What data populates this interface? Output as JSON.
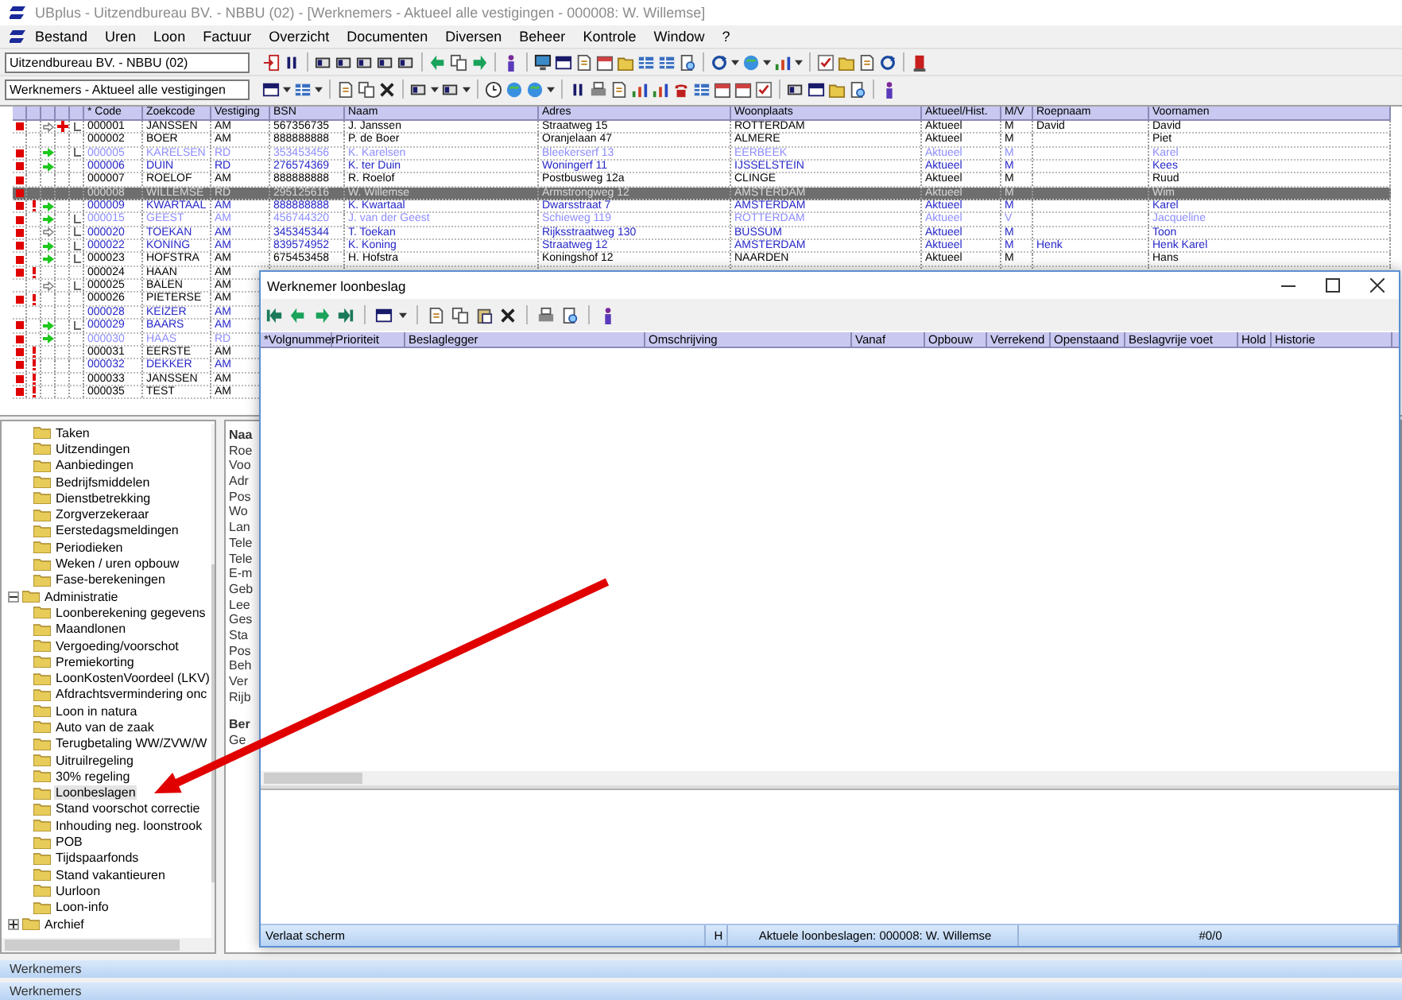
{
  "window": {
    "title": "UBplus - Uitzendbureau BV. - NBBU (02) - [Werknemers - Aktueel alle vestigingen - 000008: W. Willemse]"
  },
  "menu": [
    "Bestand",
    "Uren",
    "Loon",
    "Factuur",
    "Overzicht",
    "Documenten",
    "Diversen",
    "Beheer",
    "Kontrole",
    "Window",
    "?"
  ],
  "toolbar": {
    "company": "Uitzendbureau BV. - NBBU (02)",
    "view": "Werknemers - Aktueel alle vestigingen"
  },
  "table": {
    "columns": [
      "* Code",
      "Zoekcode",
      "Vestiging",
      "BSN",
      "Naam",
      "Adres",
      "Woonplaats",
      "Aktueel/Hist.",
      "M/V",
      "Roepnaam",
      "Voornamen"
    ],
    "rows": [
      {
        "code": "000001",
        "zoekcode": "JANSSEN",
        "vestiging": "AM",
        "bsn": "567356735",
        "naam": "J. Janssen",
        "adres": "Straatweg 15",
        "woonplaats": "ROTTERDAM",
        "aktueel": "Aktueel",
        "mv": "M",
        "roepnaam": "David",
        "voornamen": "David",
        "flag": true,
        "arrow": true,
        "arrow_filled": false,
        "cross": true,
        "link": true,
        "kind": "normal",
        "selected": false
      },
      {
        "code": "000002",
        "zoekcode": "BOER",
        "vestiging": "AM",
        "bsn": "888888888",
        "naam": "P. de Boer",
        "adres": "Oranjelaan 47",
        "woonplaats": "ALMERE",
        "aktueel": "Aktueel",
        "mv": "M",
        "voornamen": "Piet",
        "kind": "normal",
        "selected": false
      },
      {
        "code": "000005",
        "zoekcode": "KARELSEN",
        "vestiging": "RD",
        "bsn": "353453456",
        "naam": "K. Karelsen",
        "adres": "Bleekerserf 13",
        "woonplaats": "EERBEEK",
        "aktueel": "Aktueel",
        "mv": "M",
        "voornamen": "Karel",
        "flag": true,
        "arrow": true,
        "arrow_filled": true,
        "link": true,
        "kind": "light",
        "selected": false
      },
      {
        "code": "000006",
        "zoekcode": "DUIN",
        "vestiging": "RD",
        "bsn": "276574369",
        "naam": "K. ter Duin",
        "adres": "Woningerf 11",
        "woonplaats": "IJSSELSTEIN",
        "aktueel": "Aktueel",
        "mv": "M",
        "voornamen": "Kees",
        "flag": true,
        "arrow": true,
        "arrow_filled": true,
        "kind": "blue",
        "selected": false
      },
      {
        "code": "000007",
        "zoekcode": "ROELOF",
        "vestiging": "AM",
        "bsn": "888888888",
        "naam": "R. Roelof",
        "adres": "Postbusweg 12a",
        "woonplaats": "CLINGE",
        "aktueel": "Aktueel",
        "mv": "M",
        "voornamen": "Ruud",
        "flag": true,
        "kind": "normal",
        "selected": false
      },
      {
        "code": "000008",
        "zoekcode": "WILLEMSE",
        "vestiging": "RD",
        "bsn": "295125616",
        "naam": "W. Willemse",
        "adres": "Armstrongweg 12",
        "woonplaats": "AMSTERDAM",
        "aktueel": "Aktueel",
        "mv": "M",
        "voornamen": "Wim",
        "flag": true,
        "kind": "normal",
        "selected": true
      },
      {
        "code": "000009",
        "zoekcode": "KWARTAAL",
        "vestiging": "AM",
        "bsn": "888888888",
        "naam": "K. Kwartaal",
        "adres": "Dwarsstraat 7",
        "woonplaats": "AMSTERDAM",
        "aktueel": "Aktueel",
        "mv": "M",
        "voornamen": "Karel",
        "flag": true,
        "alert": true,
        "arrow": true,
        "arrow_filled": true,
        "kind": "blue",
        "selected": false
      },
      {
        "code": "000015",
        "zoekcode": "GEEST",
        "vestiging": "AM",
        "bsn": "456744320",
        "naam": "J. van der Geest",
        "adres": "Schieweg 119",
        "woonplaats": "ROTTERDAM",
        "aktueel": "Aktueel",
        "mv": "V",
        "voornamen": "Jacqueline",
        "flag": true,
        "arrow": true,
        "arrow_filled": true,
        "link": true,
        "kind": "light",
        "selected": false
      },
      {
        "code": "000020",
        "zoekcode": "TOEKAN",
        "vestiging": "AM",
        "bsn": "345345344",
        "naam": "T. Toekan",
        "adres": "Rijksstraatweg 130",
        "woonplaats": "BUSSUM",
        "aktueel": "Aktueel",
        "mv": "M",
        "voornamen": "Toon",
        "flag": true,
        "arrow": true,
        "arrow_filled": false,
        "link": true,
        "kind": "blue",
        "selected": false
      },
      {
        "code": "000022",
        "zoekcode": "KONING",
        "vestiging": "AM",
        "bsn": "839574952",
        "naam": "K. Koning",
        "adres": "Straatweg 12",
        "woonplaats": "AMSTERDAM",
        "aktueel": "Aktueel",
        "mv": "M",
        "roepnaam": "Henk",
        "voornamen": "Henk Karel",
        "flag": true,
        "arrow": true,
        "arrow_filled": true,
        "link": true,
        "kind": "blue",
        "selected": false
      },
      {
        "code": "000023",
        "zoekcode": "HOFSTRA",
        "vestiging": "AM",
        "bsn": "675453458",
        "naam": "H. Hofstra",
        "adres": "Koningshof 12",
        "woonplaats": "NAARDEN",
        "aktueel": "Aktueel",
        "mv": "M",
        "voornamen": "Hans",
        "flag": true,
        "arrow": true,
        "arrow_filled": true,
        "link": true,
        "kind": "normal",
        "selected": false
      },
      {
        "code": "000024",
        "zoekcode": "HAAN",
        "vestiging": "AM",
        "flag": true,
        "alert": true,
        "kind": "normal",
        "selected": false
      },
      {
        "code": "000025",
        "zoekcode": "BALEN",
        "vestiging": "AM",
        "arrow": true,
        "arrow_filled": false,
        "link": true,
        "kind": "normal",
        "selected": false
      },
      {
        "code": "000026",
        "zoekcode": "PIETERSE",
        "vestiging": "AM",
        "flag": true,
        "alert": true,
        "kind": "normal",
        "selected": false
      },
      {
        "code": "000028",
        "zoekcode": "KEIZER",
        "vestiging": "AM",
        "kind": "blue",
        "selected": false
      },
      {
        "code": "000029",
        "zoekcode": "BAARS",
        "vestiging": "AM",
        "flag": true,
        "arrow": true,
        "arrow_filled": true,
        "link": true,
        "kind": "blue",
        "selected": false
      },
      {
        "code": "000030",
        "zoekcode": "HAAS",
        "vestiging": "RD",
        "flag": true,
        "arrow": true,
        "arrow_filled": true,
        "kind": "light",
        "selected": false
      },
      {
        "code": "000031",
        "zoekcode": "EERSTE",
        "vestiging": "AM",
        "flag": true,
        "alert": true,
        "kind": "normal",
        "selected": false
      },
      {
        "code": "000032",
        "zoekcode": "DEKKER",
        "vestiging": "AM",
        "flag": true,
        "alert": true,
        "kind": "blue",
        "selected": false
      },
      {
        "code": "000033",
        "zoekcode": "JANSSEN",
        "vestiging": "AM",
        "flag": true,
        "alert": true,
        "kind": "normal",
        "selected": false
      },
      {
        "code": "000035",
        "zoekcode": "TEST",
        "vestiging": "AM",
        "flag": true,
        "alert": true,
        "kind": "normal",
        "selected": false
      }
    ]
  },
  "tree": {
    "partial_items": [
      {
        "label": "Taken",
        "selected": false
      },
      {
        "label": "Uitzendingen",
        "selected": false
      },
      {
        "label": "Aanbiedingen",
        "selected": false
      },
      {
        "label": "Bedrijfsmiddelen",
        "selected": false
      },
      {
        "label": "Dienstbetrekking",
        "selected": false
      },
      {
        "label": "Zorgverzekeraar",
        "selected": false
      },
      {
        "label": "Eerstedagsmeldingen",
        "selected": false
      },
      {
        "label": "Periodieken",
        "selected": false
      },
      {
        "label": "Weken / uren opbouw",
        "selected": false
      },
      {
        "label": "Fase-berekeningen",
        "selected": false
      }
    ],
    "nodes": [
      {
        "label": "Administratie",
        "expanded": true,
        "selected": false,
        "children": [
          {
            "label": "Loonberekening gegevens",
            "selected": false
          },
          {
            "label": "Maandlonen",
            "selected": false
          },
          {
            "label": "Vergoeding/voorschot",
            "selected": false
          },
          {
            "label": "Premiekorting",
            "selected": false
          },
          {
            "label": "LoonKostenVoordeel (LKV)",
            "selected": false
          },
          {
            "label": "Afdrachtsvermindering onc",
            "selected": false
          },
          {
            "label": "Loon in natura",
            "selected": false
          },
          {
            "label": "Auto van de zaak",
            "selected": false
          },
          {
            "label": "Terugbetaling WW/ZVW/W",
            "selected": false
          },
          {
            "label": "Uitruilregeling",
            "selected": false
          },
          {
            "label": "30% regeling",
            "selected": false
          },
          {
            "label": "Loonbeslagen",
            "selected": true
          },
          {
            "label": "Stand voorschot correctie",
            "selected": false
          },
          {
            "label": "Inhouding neg. loonstrook",
            "selected": false
          },
          {
            "label": "POB",
            "selected": false
          },
          {
            "label": "Tijdspaarfonds",
            "selected": false
          },
          {
            "label": "Stand vakantieuren",
            "selected": false
          },
          {
            "label": "Uurloon",
            "selected": false
          },
          {
            "label": "Loon-info",
            "selected": false
          }
        ]
      },
      {
        "label": "Archief",
        "expanded": false,
        "selected": false
      }
    ]
  },
  "details": {
    "labels": [
      {
        "text": "Naa",
        "kind": "heading"
      },
      {
        "text": "Roe",
        "kind": "field"
      },
      {
        "text": "Voo",
        "kind": "field"
      },
      {
        "text": "Adr",
        "kind": "field"
      },
      {
        "text": "Pos",
        "kind": "field"
      },
      {
        "text": "Wo",
        "kind": "field"
      },
      {
        "text": "Lan",
        "kind": "field"
      },
      {
        "text": "Tele",
        "kind": "field"
      },
      {
        "text": "Tele",
        "kind": "field"
      },
      {
        "text": "E-m",
        "kind": "field"
      },
      {
        "text": "Geb",
        "kind": "field"
      },
      {
        "text": "Lee",
        "kind": "field"
      },
      {
        "text": "Ges",
        "kind": "field"
      },
      {
        "text": "Sta",
        "kind": "field"
      },
      {
        "text": "Pos",
        "kind": "field"
      },
      {
        "text": "Beh",
        "kind": "field"
      },
      {
        "text": "Ver",
        "kind": "field"
      },
      {
        "text": "Rijb",
        "kind": "field"
      },
      {
        "text": "Ber",
        "kind": "heading"
      },
      {
        "text": "Ge",
        "kind": "field"
      }
    ]
  },
  "dialog": {
    "title": "Werknemer loonbeslag",
    "columns": [
      "*Volgnummer",
      "Prioriteit",
      "Beslaglegger",
      "Omschrijving",
      "Vanaf",
      "Opbouw",
      "Verrekend",
      "Openstaand",
      "Beslagvrije voet",
      "Hold",
      "Historie"
    ],
    "status": [
      "Verlaat scherm",
      "H",
      "Aktuele loonbeslagen: 000008: W. Willemse",
      "#0/0"
    ]
  },
  "bottom_tabs": [
    "Werknemers",
    "Werknemers"
  ]
}
